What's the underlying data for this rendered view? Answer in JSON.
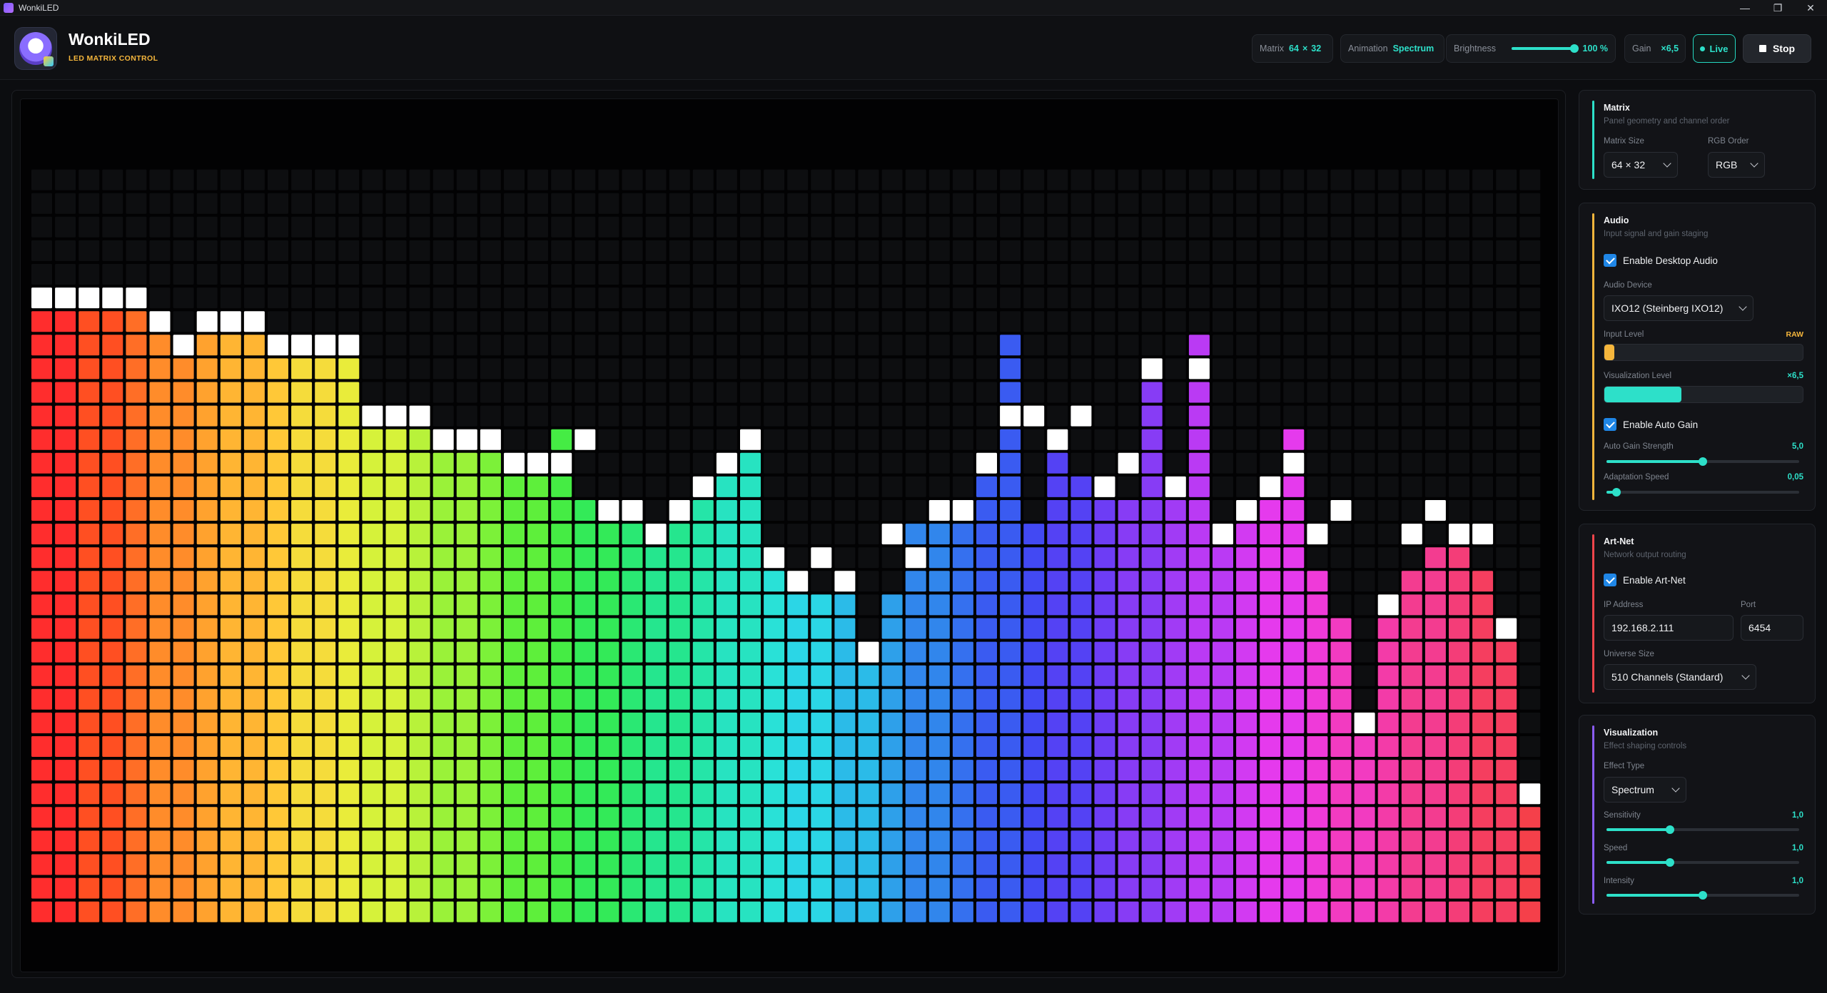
{
  "window": {
    "title": "WonkiLED",
    "controls": [
      "—",
      "❐",
      "✕"
    ]
  },
  "header": {
    "brand_name": "WonkiLED",
    "brand_subtitle": "LED MATRIX CONTROL",
    "matrix_chip": {
      "label": "Matrix",
      "cols": "64",
      "x": "×",
      "rows": "32"
    },
    "animation_chip": {
      "label": "Animation",
      "value": "Spectrum"
    },
    "brightness_chip": {
      "label": "Brightness",
      "value": "100 %",
      "level": 1.0
    },
    "gain_chip": {
      "label": "Gain",
      "value": "×6,5"
    },
    "live_label": "Live",
    "stop_label": "Stop"
  },
  "matrix": {
    "cols": 64,
    "rows": 32,
    "bar_heights": [
      26,
      26,
      26,
      26,
      26,
      25,
      24,
      25,
      25,
      25,
      24,
      24,
      24,
      24,
      21,
      21,
      21,
      20,
      20,
      20,
      19,
      19,
      21,
      18,
      17,
      17,
      16,
      17,
      18,
      19,
      21,
      15,
      14,
      14,
      15,
      12,
      14,
      17,
      17,
      18,
      20,
      25,
      17,
      21,
      19,
      19,
      18,
      24,
      19,
      25,
      16,
      18,
      19,
      21,
      15,
      13,
      9,
      13,
      15,
      16,
      16,
      15,
      12,
      5
    ],
    "peak_heights": [
      27,
      27,
      27,
      27,
      27,
      26,
      25,
      26,
      26,
      26,
      25,
      25,
      25,
      25,
      22,
      22,
      22,
      21,
      21,
      21,
      20,
      20,
      20,
      21,
      18,
      18,
      17,
      18,
      19,
      20,
      21,
      16,
      15,
      16,
      15,
      12,
      17,
      16,
      18,
      18,
      20,
      22,
      22,
      21,
      22,
      19,
      20,
      24,
      19,
      24,
      17,
      18,
      19,
      20,
      17,
      18,
      9,
      14,
      17,
      18,
      17,
      17,
      13,
      6
    ],
    "colors": [
      "#ff2d2d",
      "#ff4f22",
      "#ff6e26",
      "#ff8c2a",
      "#ffa22e",
      "#ffb533",
      "#ffc837",
      "#f5dc3b",
      "#e9ec3a",
      "#d6f23a",
      "#b8f23a",
      "#9af239",
      "#7cf139",
      "#5eef3b",
      "#45ec44",
      "#33ea58",
      "#2ae873",
      "#25e68e",
      "#25e5a8",
      "#27e3c1",
      "#29e1d7",
      "#2bd6e6",
      "#2bbbe8",
      "#2ea0ea",
      "#3186ec",
      "#3570ef",
      "#3a5bf1",
      "#4249f3",
      "#5442f4",
      "#6d3df5",
      "#873cf5",
      "#a13bf5",
      "#ba3af4",
      "#d23af2",
      "#e53aed",
      "#ef3ad9",
      "#f23bc1",
      "#f33ba8",
      "#f33c90",
      "#f43d78",
      "#f53e5f",
      "#f5404a"
    ],
    "peak_color": "#ffffff"
  },
  "sidebar": {
    "matrix_panel": {
      "title": "Matrix",
      "subtitle": "Panel geometry and channel order",
      "size_label": "Matrix Size",
      "size_value": "64 × 32",
      "rgb_label": "RGB Order",
      "rgb_value": "RGB",
      "accent": "#2de0c9"
    },
    "audio_panel": {
      "title": "Audio",
      "subtitle": "Input signal and gain staging",
      "enable_desktop_audio": "Enable Desktop Audio",
      "device_label": "Audio Device",
      "device_value": "IXO12 (Steinberg IXO12)",
      "input_level_label": "Input Level",
      "input_level_tag": "RAW",
      "input_level": 0.05,
      "viz_level_label": "Visualization Level",
      "viz_level_tag": "×6,5",
      "viz_level": 0.39,
      "enable_auto_gain": "Enable Auto Gain",
      "auto_gain_label": "Auto Gain Strength",
      "auto_gain_value": "5,0",
      "auto_gain_level": 0.5,
      "adapt_label": "Adaptation Speed",
      "adapt_value": "0,05",
      "adapt_level": 0.05,
      "accent": "#f5b63c"
    },
    "artnet_panel": {
      "title": "Art-Net",
      "subtitle": "Network output routing",
      "enable_artnet": "Enable Art-Net",
      "ip_label": "IP Address",
      "ip_value": "192.168.2.111",
      "port_label": "Port",
      "port_value": "6454",
      "universe_label": "Universe Size",
      "universe_value": "510 Channels (Standard)",
      "accent": "#f0454b"
    },
    "viz_panel": {
      "title": "Visualization",
      "subtitle": "Effect shaping controls",
      "effect_label": "Effect Type",
      "effect_value": "Spectrum",
      "sensitivity_label": "Sensitivity",
      "sensitivity_value": "1,0",
      "sensitivity_level": 0.33,
      "speed_label": "Speed",
      "speed_value": "1,0",
      "speed_level": 0.33,
      "intensity_label": "Intensity",
      "intensity_value": "1,0",
      "intensity_level": 0.5,
      "accent": "#8b5cf6"
    }
  }
}
